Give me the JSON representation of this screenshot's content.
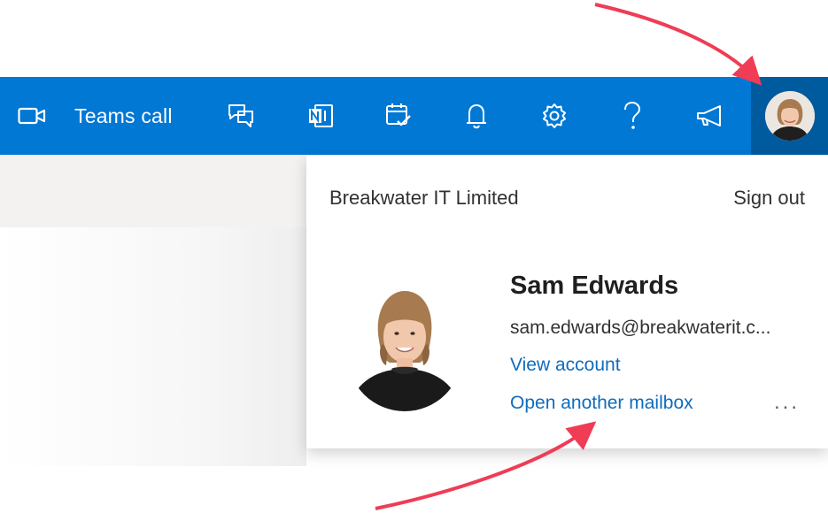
{
  "topbar": {
    "teams_call_label": "Teams call",
    "icons": [
      "video-camera-icon",
      "chat-feedback-icon",
      "onenote-icon",
      "calendar-check-icon",
      "bell-icon",
      "gear-icon",
      "help-question-icon",
      "megaphone-icon"
    ],
    "background_color": "#0078d4",
    "active_background_color": "#005a9e"
  },
  "account_menu": {
    "organization": "Breakwater IT Limited",
    "sign_out_label": "Sign out",
    "user_name": "Sam Edwards",
    "user_email": "sam.edwards@breakwaterit.c...",
    "view_account_label": "View account",
    "open_another_mailbox_label": "Open another mailbox",
    "more_label": "...",
    "link_color": "#0f6cbd"
  },
  "annotations": {
    "arrow_color": "#f03c55"
  }
}
